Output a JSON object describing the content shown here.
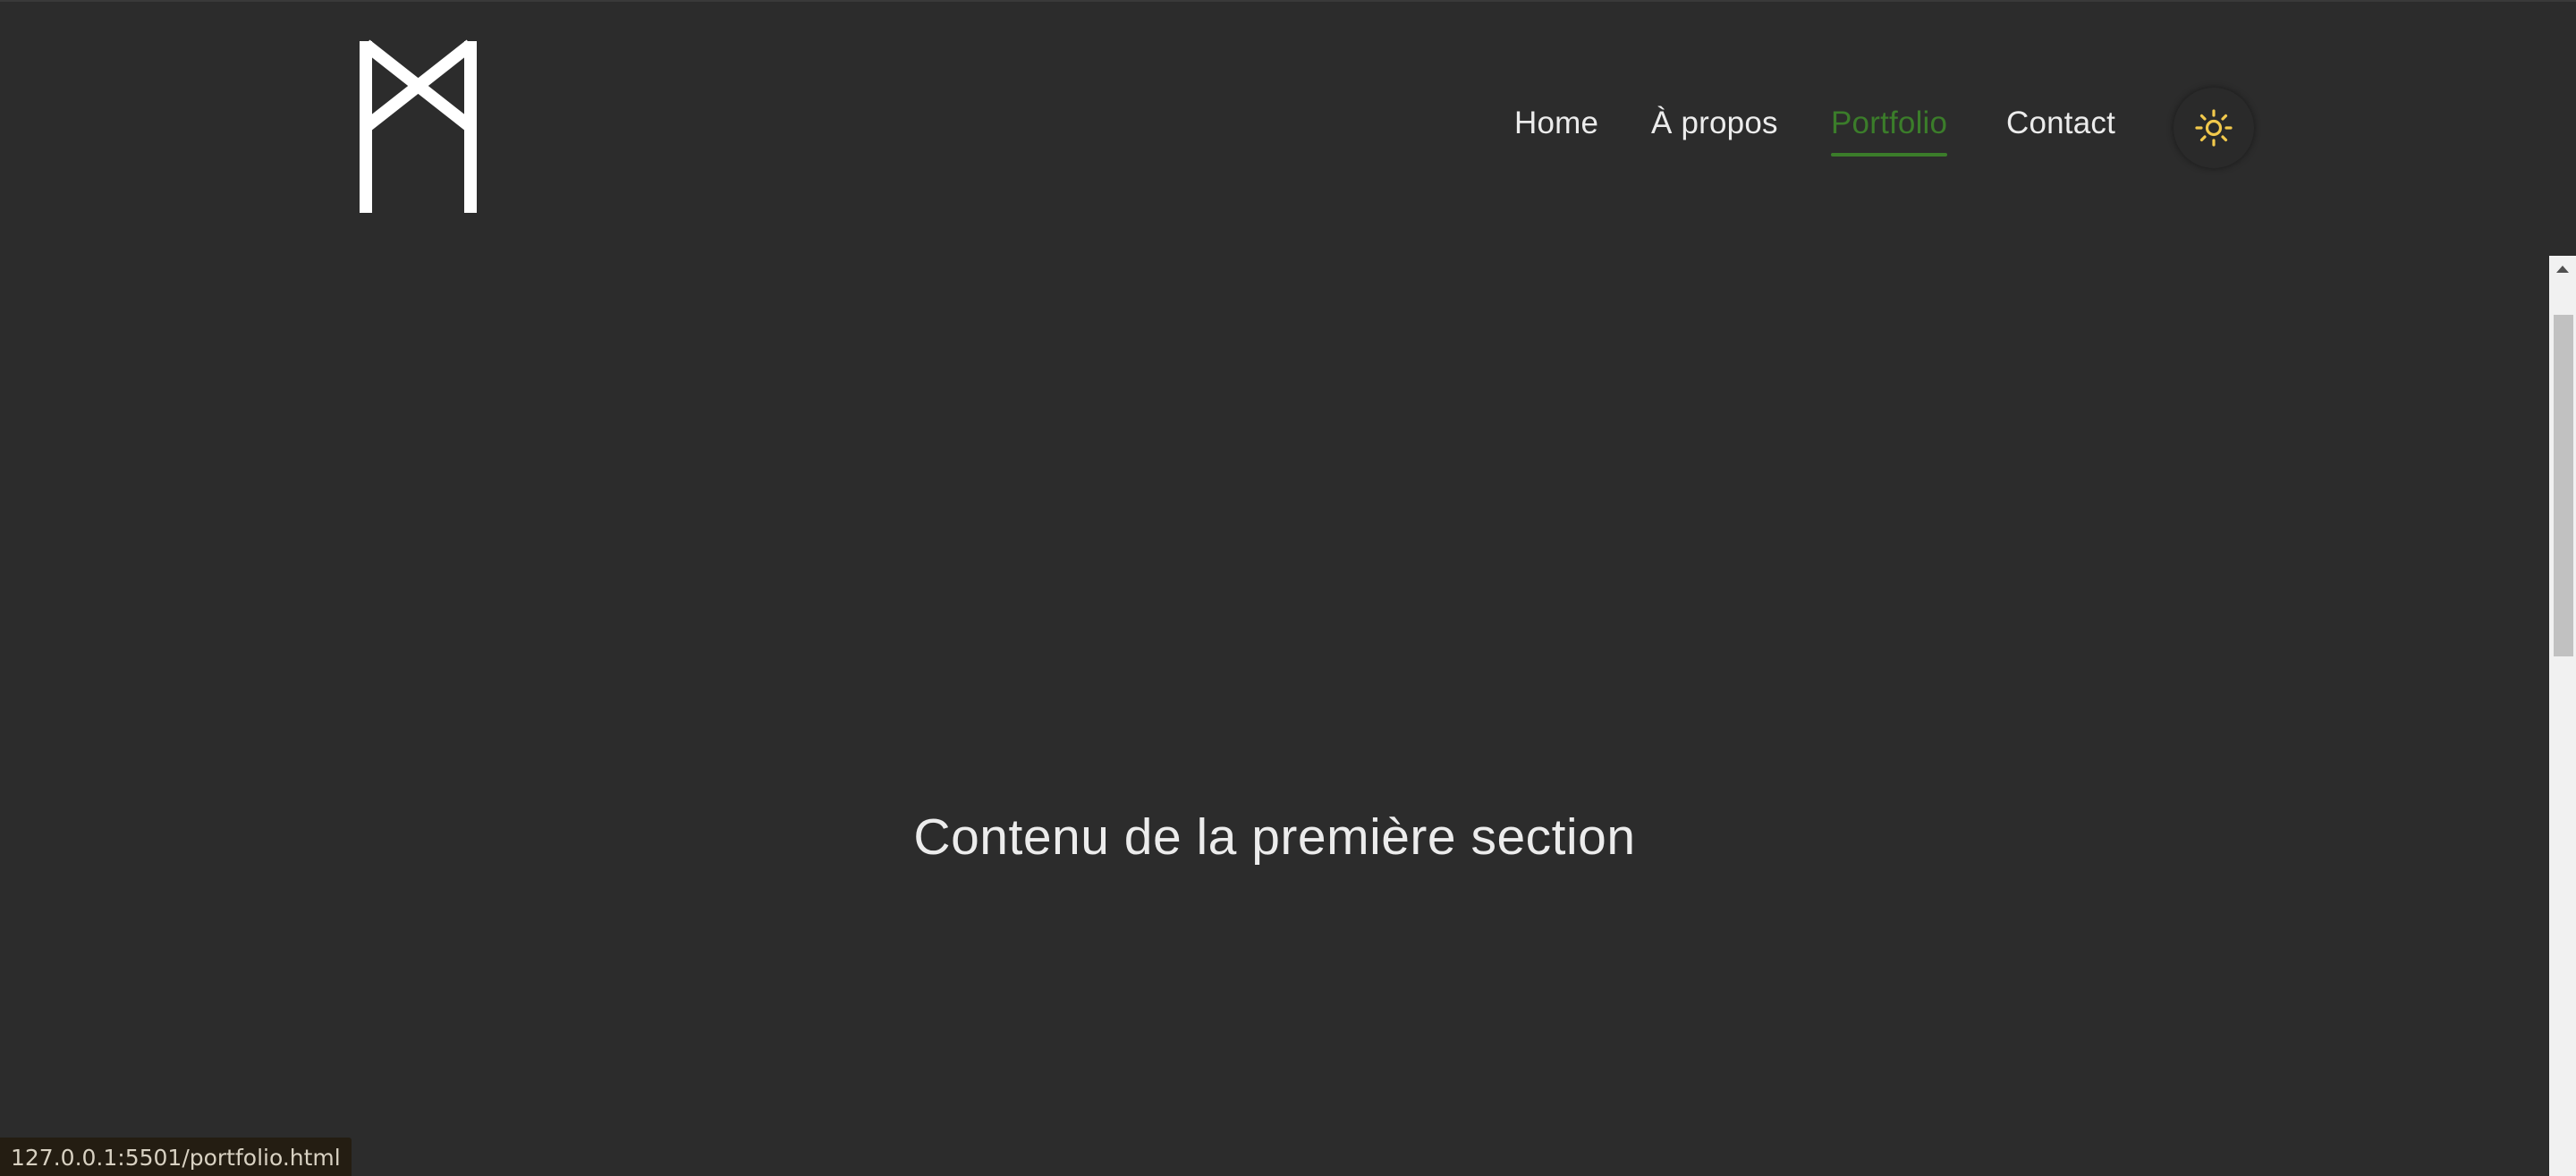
{
  "header": {
    "logo_icon": "stylized-m-monogram-icon",
    "nav": {
      "home_label": "Home",
      "about_label": "À propos",
      "portfolio_label": "Portfolio",
      "contact_label": "Contact",
      "active_item": "Portfolio"
    },
    "theme_toggle_icon": "sun-icon"
  },
  "main": {
    "section_text": "Contenu de la première section"
  },
  "status_bar": {
    "url": "127.0.0.1:5501/portfolio.html"
  },
  "colors": {
    "background": "#2c2c2c",
    "text": "#ececec",
    "accent": "#3b7d2a",
    "sun": "#f2c94c"
  }
}
